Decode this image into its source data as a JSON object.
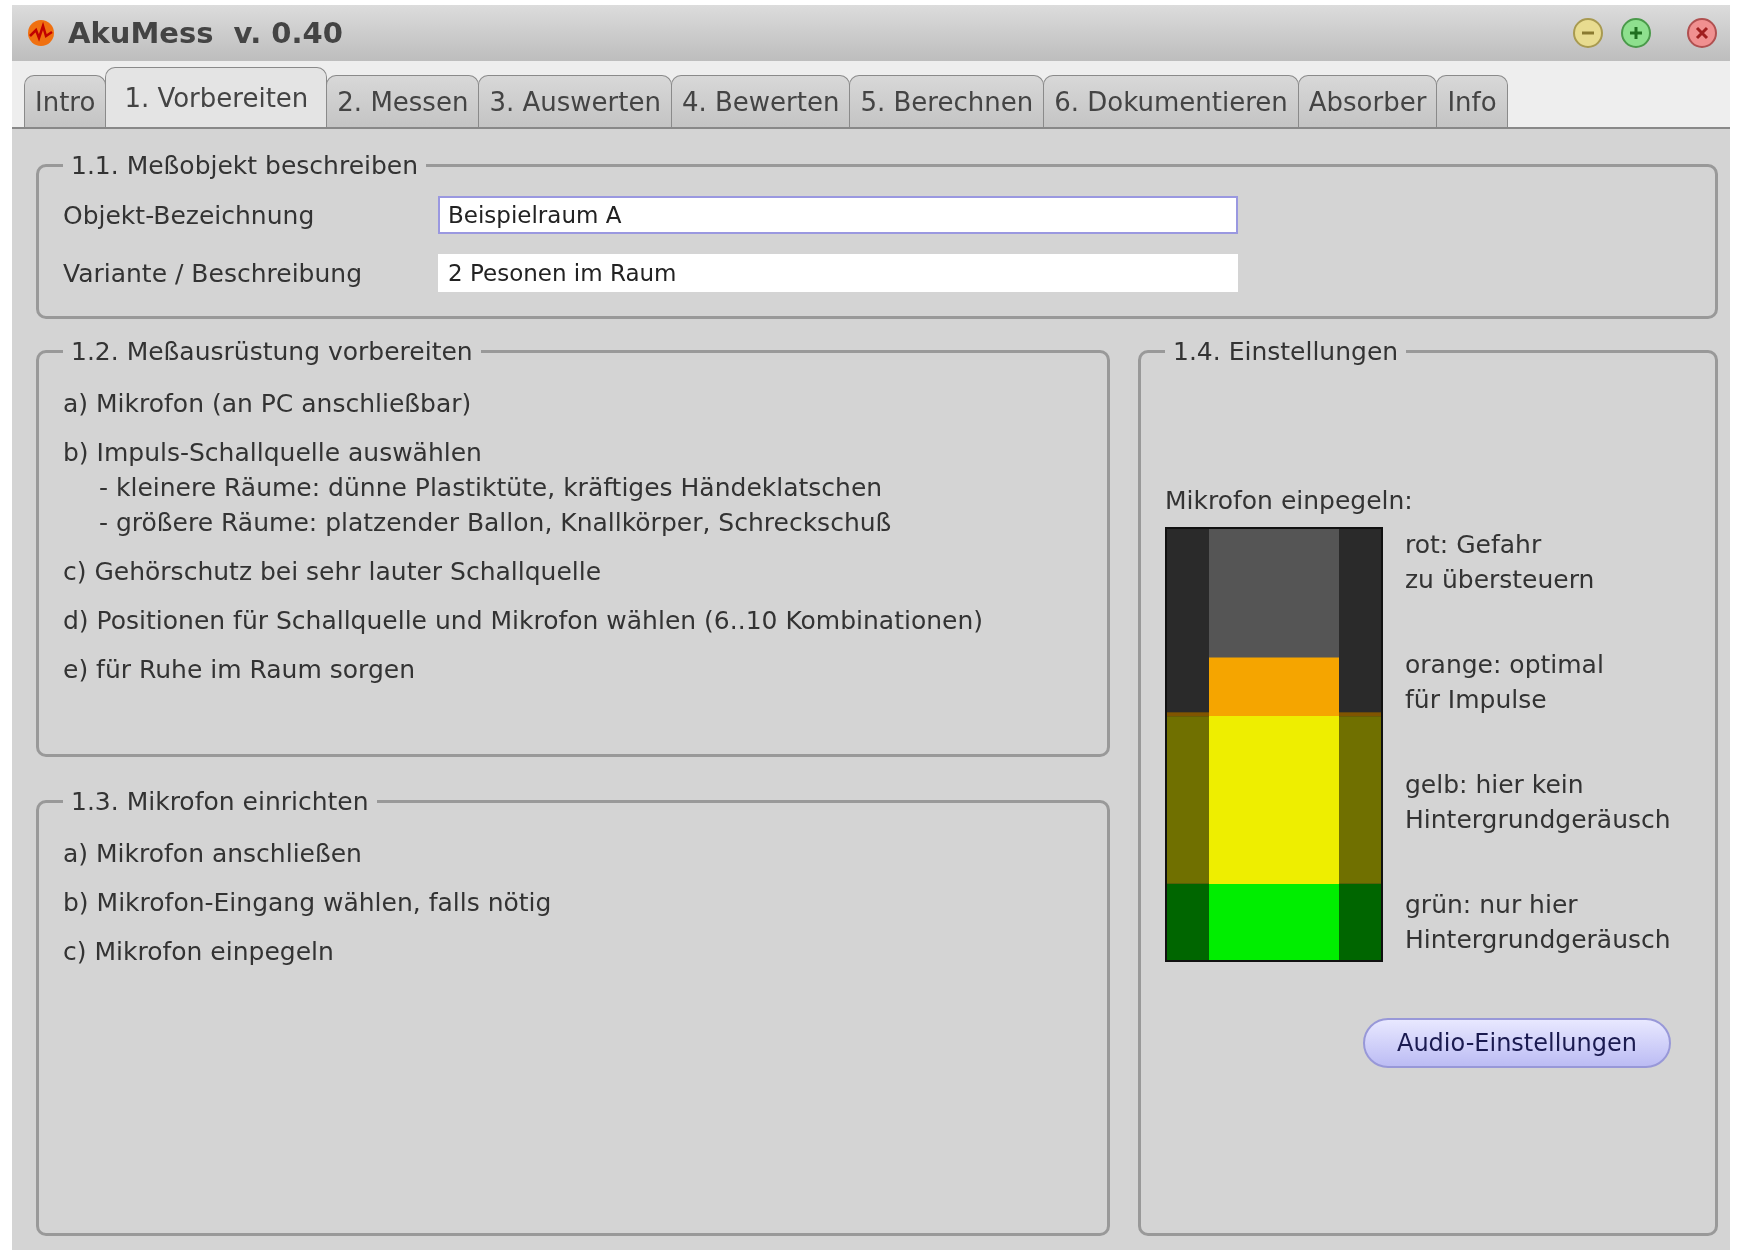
{
  "window": {
    "title": "AkuMess  v. 0.40"
  },
  "tabs": [
    {
      "label": "Intro",
      "selected": false
    },
    {
      "label": "1. Vorbereiten",
      "selected": true
    },
    {
      "label": "2. Messen",
      "selected": false
    },
    {
      "label": "3. Auswerten",
      "selected": false
    },
    {
      "label": "4. Bewerten",
      "selected": false
    },
    {
      "label": "5. Berechnen",
      "selected": false
    },
    {
      "label": "6. Dokumentieren",
      "selected": false
    },
    {
      "label": "Absorber",
      "selected": false
    },
    {
      "label": "Info",
      "selected": false
    }
  ],
  "object_section": {
    "title": "1.1. Meßobjekt beschreiben",
    "fields": [
      {
        "label": "Objekt-Bezeichnung",
        "value": "Beispielraum A",
        "focused": true
      },
      {
        "label": "Variante / Beschreibung",
        "value": "2 Pesonen im Raum",
        "focused": false
      }
    ]
  },
  "equipment_section": {
    "title": "1.2. Meßausrüstung vorbereiten",
    "items": [
      {
        "text": "a) Mikrofon (an PC anschließbar)"
      },
      {
        "text": "b) Impuls-Schallquelle auswählen",
        "children": [
          {
            "text": "- kleinere Räume: dünne Plastiktüte, kräftiges Händeklatschen"
          },
          {
            "text": "- größere Räume: platzender Ballon, Knallkörper, Schreckschuß"
          }
        ]
      },
      {
        "text": "c) Gehörschutz bei sehr lauter Schallquelle"
      },
      {
        "text": "d) Positionen für Schallquelle und Mikrofon wählen (6..10 Kombinationen)"
      },
      {
        "text": "e) für Ruhe im Raum sorgen"
      }
    ]
  },
  "microphone_section": {
    "title": "1.3. Mikrofon einrichten",
    "items": [
      {
        "text": "a) Mikrofon anschließen"
      },
      {
        "text": "b) Mikrofon-Eingang wählen, falls nötig"
      },
      {
        "text": "c) Mikrofon einpegeln"
      }
    ]
  },
  "settings_section": {
    "title": "1.4. Einstellungen",
    "meter_label": "Mikrofon einpegeln:",
    "meter": {
      "level": 0.7
    },
    "legend": [
      {
        "lines": [
          "rot: Gefahr",
          "zu übersteuern"
        ]
      },
      {
        "lines": [
          "orange: optimal",
          "für Impulse"
        ]
      },
      {
        "lines": [
          "gelb: hier kein",
          "Hintergrundgeräusch"
        ]
      },
      {
        "lines": [
          "grün: nur hier",
          "Hintergrundgeräusch"
        ]
      }
    ],
    "button": "Audio-Einstellungen"
  }
}
